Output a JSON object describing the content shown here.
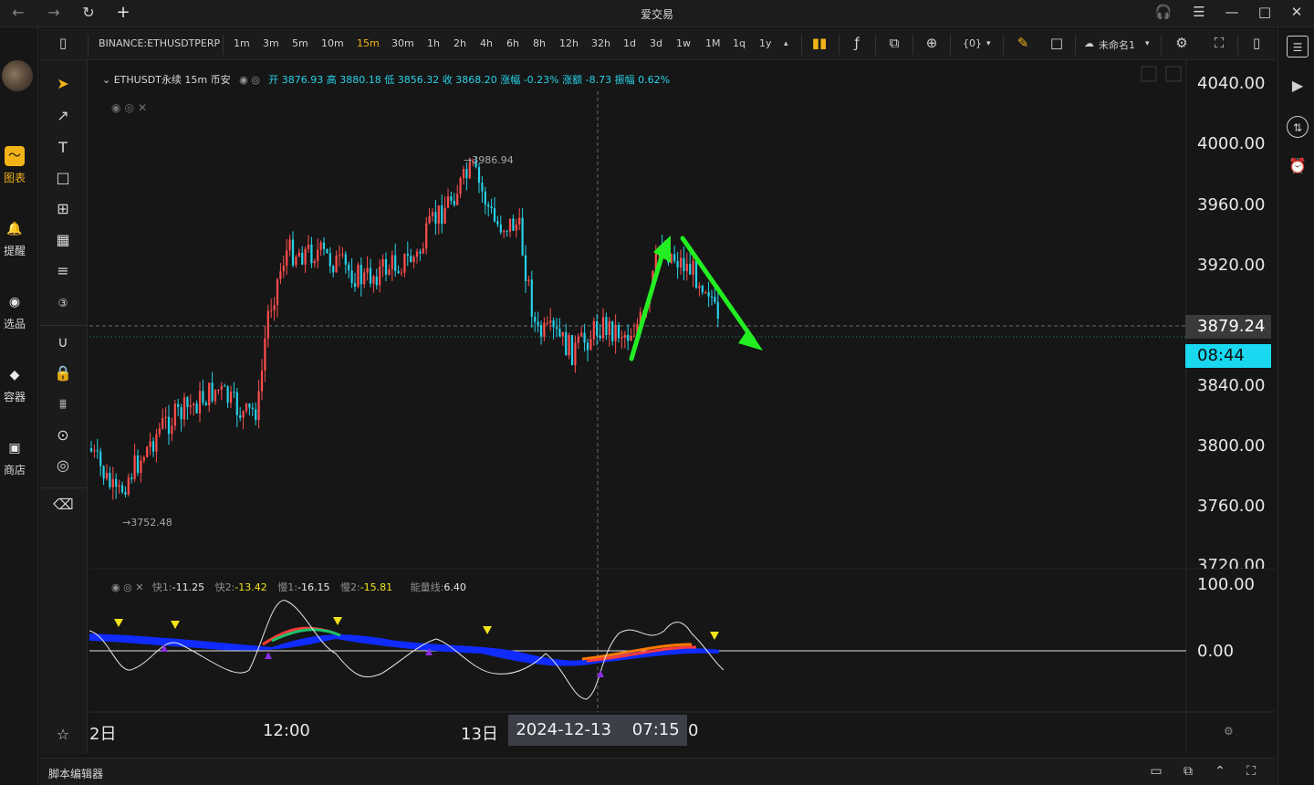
{
  "window": {
    "title": "爱交易",
    "nav_back": "←",
    "nav_forward": "→",
    "reload": "↻",
    "new_tab": "+",
    "headset": "🎧",
    "menu": "☰",
    "minimize": "—",
    "maximize": "□",
    "close": "✕"
  },
  "appnav": {
    "items": [
      {
        "label": "图表",
        "icon": "chart-icon",
        "glyph": "〜",
        "active": true
      },
      {
        "label": "提醒",
        "icon": "bell-icon",
        "glyph": "🔔",
        "active": false
      },
      {
        "label": "选品",
        "icon": "screener-icon",
        "glyph": "◉",
        "active": false
      },
      {
        "label": "容器",
        "icon": "container-icon",
        "glyph": "◆",
        "active": false
      },
      {
        "label": "商店",
        "icon": "store-icon",
        "glyph": "▣",
        "active": false
      }
    ]
  },
  "toolbar": {
    "symbol": "BINANCE:ETHUSDTPERP",
    "intervals": [
      "1m",
      "3m",
      "5m",
      "10m",
      "15m",
      "30m",
      "1h",
      "2h",
      "4h",
      "6h",
      "8h",
      "12h",
      "32h",
      "1d",
      "3d",
      "1w",
      "1M",
      "1q",
      "1y"
    ],
    "selected_interval": "15m",
    "more": "▴",
    "braces": "{0}",
    "layout_name": "未命名1"
  },
  "legend": {
    "symbol_line": "ETHUSDT永续 15m 币安",
    "values": "开 3876.93 高 3880.18 低 3856.32 收 3868.20 涨幅 -0.23% 涨额 -8.73 振幅 0.62%"
  },
  "indicator_legend": {
    "fast1_label": "快1:",
    "fast1_value": "-11.25",
    "fast2_label": "快2:",
    "fast2_value": "-13.42",
    "slow1_label": "慢1:",
    "slow1_value": "-16.15",
    "slow2_label": "慢2:",
    "slow2_value": "-15.81",
    "energy_label": "能量线:",
    "energy_value": "6.40"
  },
  "chart_labels": {
    "high": "→3986.94",
    "low": "→3752.48"
  },
  "price_axis": {
    "ticks": [
      "4040.00",
      "4000.00",
      "3960.00",
      "3920.00",
      "3840.00",
      "3800.00",
      "3760.00",
      "3720.00"
    ],
    "indicator_ticks": [
      "100.00",
      "0.00"
    ],
    "current_price": "3879.24",
    "countdown": "08:44"
  },
  "time_axis": {
    "ticks": [
      "2日",
      "12:00",
      "13日",
      "0"
    ],
    "cursor_label": "2024-12-13    07:15"
  },
  "bottombar": {
    "label": "脚本编辑器"
  },
  "colors": {
    "accent": "#f2b318",
    "up": "#ff4d4d",
    "down": "#26d1e8",
    "arrow": "#22ee22",
    "energy": "#0f2bff"
  }
}
